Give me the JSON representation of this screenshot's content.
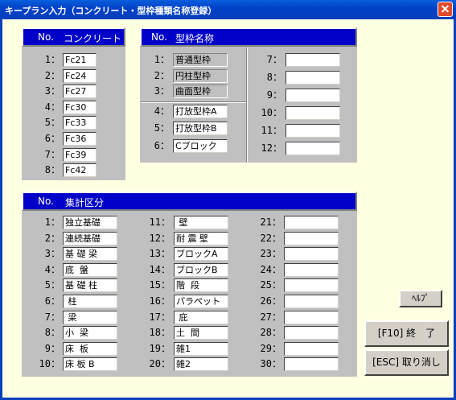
{
  "window": {
    "title": "キープラン入力（コンクリート・型枠種類名称登録）"
  },
  "concrete": {
    "header_no": "No.",
    "header_name": "コンクリート",
    "rows": [
      {
        "no": "1：",
        "value": "Fc21"
      },
      {
        "no": "2：",
        "value": "Fc24"
      },
      {
        "no": "3：",
        "value": "Fc27"
      },
      {
        "no": "4：",
        "value": "Fc30"
      },
      {
        "no": "5：",
        "value": "Fc33"
      },
      {
        "no": "6：",
        "value": "Fc36"
      },
      {
        "no": "7：",
        "value": "Fc39"
      },
      {
        "no": "8：",
        "value": "Fc42"
      }
    ]
  },
  "formwork": {
    "header_no": "No.",
    "header_name": "型枠名称",
    "col1": [
      {
        "no": "1：",
        "value": "普通型枠"
      },
      {
        "no": "2：",
        "value": "円柱型枠"
      },
      {
        "no": "3：",
        "value": "曲面型枠"
      },
      {
        "no": "4：",
        "value": "打放型枠A"
      },
      {
        "no": "5：",
        "value": "打放型枠B"
      },
      {
        "no": "6：",
        "value": "Cブロック"
      }
    ],
    "col2": [
      {
        "no": "7：",
        "value": ""
      },
      {
        "no": "8：",
        "value": ""
      },
      {
        "no": "9：",
        "value": ""
      },
      {
        "no": "10：",
        "value": ""
      },
      {
        "no": "11：",
        "value": ""
      },
      {
        "no": "12：",
        "value": ""
      }
    ]
  },
  "summary": {
    "header_no": "No.",
    "header_name": "集計区分",
    "col1": [
      {
        "no": "1：",
        "value": "独立基礎"
      },
      {
        "no": "2：",
        "value": "連続基礎"
      },
      {
        "no": "3：",
        "value": "基 礎 梁"
      },
      {
        "no": "4：",
        "value": "底  盤"
      },
      {
        "no": "5：",
        "value": "基 礎 柱"
      },
      {
        "no": "6：",
        "value": " 柱"
      },
      {
        "no": "7：",
        "value": " 梁"
      },
      {
        "no": "8：",
        "value": "小  梁"
      },
      {
        "no": "9：",
        "value": "床  板"
      },
      {
        "no": "10：",
        "value": "床 板 B"
      }
    ],
    "col2": [
      {
        "no": "11：",
        "value": " 壁"
      },
      {
        "no": "12：",
        "value": "耐 震 壁"
      },
      {
        "no": "13：",
        "value": "ブロックA"
      },
      {
        "no": "14：",
        "value": "ブロックB"
      },
      {
        "no": "15：",
        "value": "階  段"
      },
      {
        "no": "16：",
        "value": "パラペット"
      },
      {
        "no": "17：",
        "value": " 庇"
      },
      {
        "no": "18：",
        "value": "土  間"
      },
      {
        "no": "19：",
        "value": "雑1"
      },
      {
        "no": "20：",
        "value": "雑2"
      }
    ],
    "col3": [
      {
        "no": "21：",
        "value": ""
      },
      {
        "no": "22：",
        "value": ""
      },
      {
        "no": "23：",
        "value": ""
      },
      {
        "no": "24：",
        "value": ""
      },
      {
        "no": "25：",
        "value": ""
      },
      {
        "no": "26：",
        "value": ""
      },
      {
        "no": "27：",
        "value": ""
      },
      {
        "no": "28：",
        "value": ""
      },
      {
        "no": "29：",
        "value": ""
      },
      {
        "no": "30：",
        "value": ""
      }
    ]
  },
  "buttons": {
    "help": "ﾍﾙﾌﾟ",
    "finish": "[F10] 終　了",
    "cancel": "[ESC] 取り消し"
  }
}
